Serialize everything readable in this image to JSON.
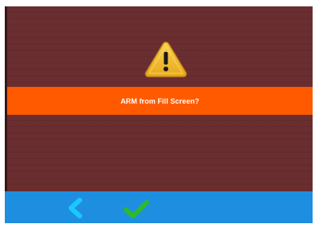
{
  "dialog": {
    "message": "ARM from Fill Screen?",
    "warning_icon": "warning-triangle-icon"
  },
  "toolbar": {
    "back_icon": "chevron-left-icon",
    "confirm_icon": "checkmark-icon"
  },
  "colors": {
    "background": "#6b2e30",
    "banner": "#ff5a00",
    "bottom_bar": "#1e8fe0",
    "back_chevron": "#19c8ff",
    "checkmark": "#2eb82e",
    "warning_fill": "#f2c230"
  }
}
